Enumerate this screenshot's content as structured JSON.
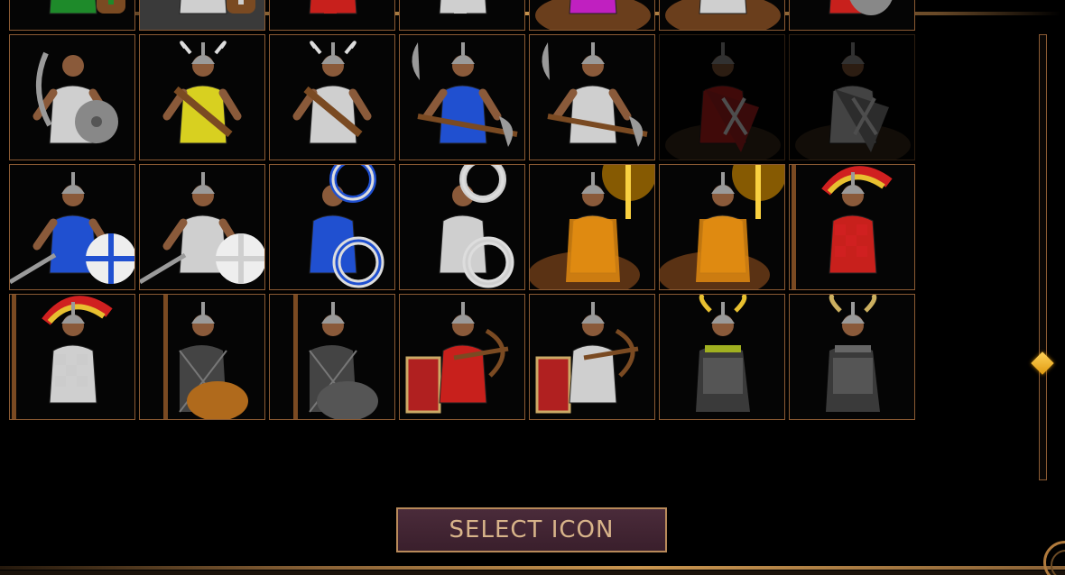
{
  "dialog": {
    "select_button_label": "SELECT ICON"
  },
  "colors": {
    "gold_border": "#8a5a33",
    "button_bg": "#3f2331",
    "button_text": "#d8b48a",
    "scroll_thumb": "#f0b020"
  },
  "icon_grid": {
    "rows": [
      [
        {
          "unit": "axe-warrior-green-shield",
          "tint": "green",
          "state": "normal"
        },
        {
          "unit": "axe-warrior-green-shield",
          "tint": "white",
          "state": "selected"
        },
        {
          "unit": "crossbowman",
          "tint": "red",
          "state": "normal"
        },
        {
          "unit": "crossbowman",
          "tint": "white",
          "state": "normal"
        },
        {
          "unit": "horse-archer",
          "tint": "magenta",
          "state": "normal"
        },
        {
          "unit": "horse-archer",
          "tint": "white",
          "state": "normal"
        },
        {
          "unit": "sickle-warrior-red-shield",
          "tint": "red",
          "state": "normal"
        }
      ],
      [
        {
          "unit": "sickle-warrior-round-shield",
          "tint": "white",
          "state": "normal"
        },
        {
          "unit": "horned-helm-warrior",
          "tint": "yellow",
          "state": "normal"
        },
        {
          "unit": "horned-helm-warrior",
          "tint": "white",
          "state": "normal"
        },
        {
          "unit": "axeman",
          "tint": "blue",
          "state": "normal"
        },
        {
          "unit": "axeman",
          "tint": "white",
          "state": "normal"
        },
        {
          "unit": "cavalry-kite-shield",
          "tint": "red",
          "state": "dimmed"
        },
        {
          "unit": "cavalry-kite-shield",
          "tint": "white",
          "state": "dimmed"
        }
      ],
      [
        {
          "unit": "swordsman-round-shield",
          "tint": "blue",
          "state": "normal"
        },
        {
          "unit": "swordsman-round-shield",
          "tint": "white",
          "state": "normal"
        },
        {
          "unit": "chakram-thrower",
          "tint": "blue",
          "state": "normal"
        },
        {
          "unit": "chakram-thrower",
          "tint": "white",
          "state": "normal"
        },
        {
          "unit": "torch-rider",
          "tint": "orange",
          "state": "normal"
        },
        {
          "unit": "torch-rider",
          "tint": "orange",
          "state": "normal"
        },
        {
          "unit": "winged-hussar",
          "tint": "red",
          "state": "normal"
        }
      ],
      [
        {
          "unit": "winged-hussar",
          "tint": "white",
          "state": "normal"
        },
        {
          "unit": "mail-spearman",
          "tint": "orange",
          "state": "normal"
        },
        {
          "unit": "mail-spearman",
          "tint": "white",
          "state": "normal"
        },
        {
          "unit": "crossbow-cavalry",
          "tint": "red",
          "state": "normal"
        },
        {
          "unit": "crossbow-cavalry",
          "tint": "white",
          "state": "normal"
        },
        {
          "unit": "horned-armored-warrior",
          "tint": "yellow",
          "state": "normal"
        },
        {
          "unit": "horned-armored-warrior",
          "tint": "white",
          "state": "normal"
        }
      ]
    ]
  },
  "scrollbar": {
    "position_fraction": 0.73
  }
}
